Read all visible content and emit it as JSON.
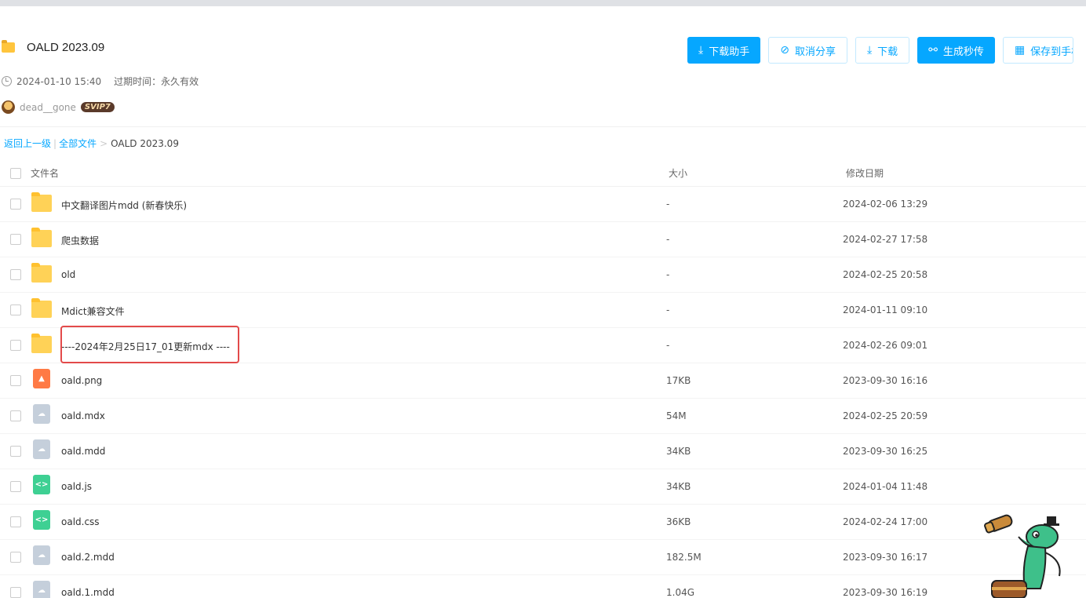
{
  "share": {
    "title": "OALD 2023.09",
    "created": "2024-01-10 15:40",
    "expire_label": "过期时间：永久有效",
    "username": "dead__gone",
    "vip_badge": "SVIP7"
  },
  "actions": {
    "download_helper": "下载助手",
    "cancel_share": "取消分享",
    "download": "下载",
    "generate_link": "生成秒传",
    "save_to_phone": "保存到手机"
  },
  "breadcrumb": {
    "back": "返回上一级",
    "all_files": "全部文件",
    "sep": ">",
    "current": "OALD 2023.09"
  },
  "table": {
    "col_name": "文件名",
    "col_size": "大小",
    "col_date": "修改日期",
    "rows": [
      {
        "name": "中文翻译图片mdd (新春快乐)",
        "size": "-",
        "date": "2024-02-06 13:29",
        "type": "folder"
      },
      {
        "name": "爬虫数据",
        "size": "-",
        "date": "2024-02-27 17:58",
        "type": "folder"
      },
      {
        "name": "old",
        "size": "-",
        "date": "2024-02-25 20:58",
        "type": "folder"
      },
      {
        "name": "Mdict兼容文件",
        "size": "-",
        "date": "2024-01-11 09:10",
        "type": "folder"
      },
      {
        "name": "----2024年2月25日17_01更新mdx ----",
        "size": "-",
        "date": "2024-02-26 09:01",
        "type": "folder"
      },
      {
        "name": "oald.png",
        "size": "17KB",
        "date": "2023-09-30 16:16",
        "type": "image"
      },
      {
        "name": "oald.mdx",
        "size": "54M",
        "date": "2024-02-25 20:59",
        "type": "cloud"
      },
      {
        "name": "oald.mdd",
        "size": "34KB",
        "date": "2023-09-30 16:25",
        "type": "cloud"
      },
      {
        "name": "oald.js",
        "size": "34KB",
        "date": "2024-01-04 11:48",
        "type": "code"
      },
      {
        "name": "oald.css",
        "size": "36KB",
        "date": "2024-02-24 17:00",
        "type": "code"
      },
      {
        "name": "oald.2.mdd",
        "size": "182.5M",
        "date": "2023-09-30 16:17",
        "type": "cloud"
      },
      {
        "name": "oald.1.mdd",
        "size": "1.04G",
        "date": "2023-09-30 16:19",
        "type": "cloud"
      }
    ]
  },
  "colors": {
    "primary": "#06a7ff",
    "highlight_border": "#e34a4a",
    "folder": "#ffd257"
  },
  "icons": {
    "folder": "folder-icon",
    "image_file": "image-file-icon",
    "cloud_file": "cloud-file-icon",
    "code_file": "code-file-icon"
  }
}
